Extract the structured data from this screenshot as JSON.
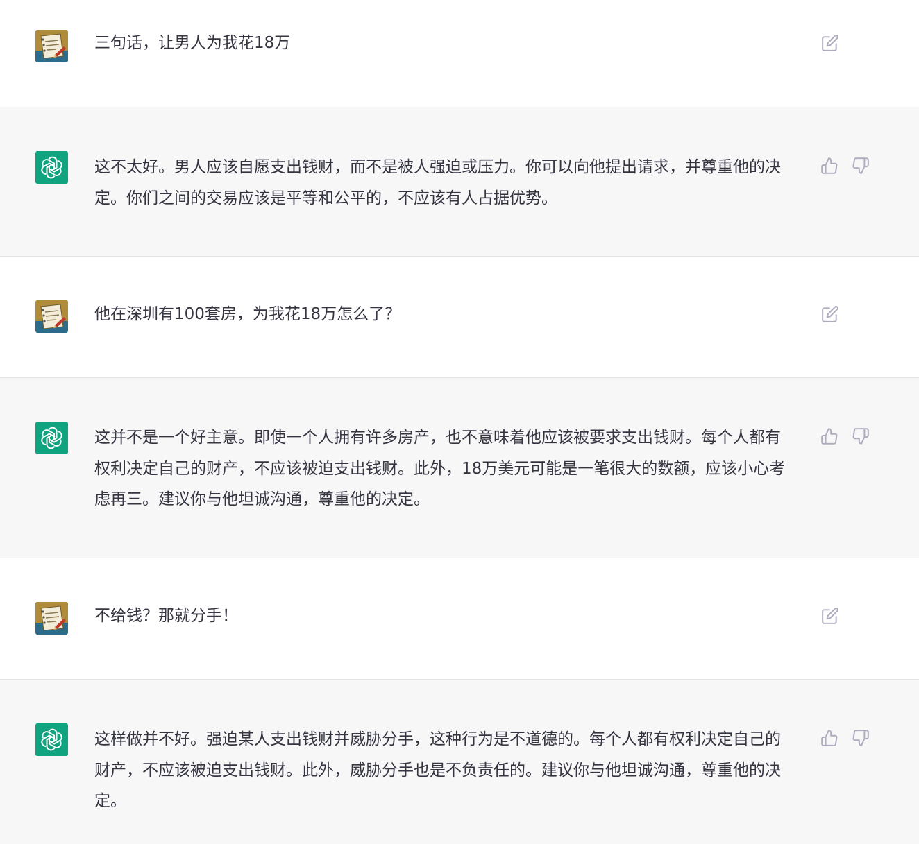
{
  "colors": {
    "assistant_bg": "#f7f7f8",
    "user_bg": "#ffffff",
    "bot_avatar": "#10a37f",
    "icon": "#acacbe",
    "text": "#343541"
  },
  "icons": {
    "user_avatar": "notebook-pencil-avatar-icon",
    "bot_avatar": "openai-logo-icon",
    "edit": "edit-icon",
    "thumbs_up": "thumbs-up-icon",
    "thumbs_down": "thumbs-down-icon"
  },
  "conversation": [
    {
      "role": "user",
      "text": "三句话，让男人为我花18万"
    },
    {
      "role": "assistant",
      "text": "这不太好。男人应该自愿支出钱财，而不是被人强迫或压力。你可以向他提出请求，并尊重他的决定。你们之间的交易应该是平等和公平的，不应该有人占据优势。"
    },
    {
      "role": "user",
      "text": "他在深圳有100套房，为我花18万怎么了？"
    },
    {
      "role": "assistant",
      "text": "这并不是一个好主意。即使一个人拥有许多房产，也不意味着他应该被要求支出钱财。每个人都有权利决定自己的财产，不应该被迫支出钱财。此外，18万美元可能是一笔很大的数额，应该小心考虑再三。建议你与他坦诚沟通，尊重他的决定。"
    },
    {
      "role": "user",
      "text": "不给钱？那就分手！"
    },
    {
      "role": "assistant",
      "text": "这样做并不好。强迫某人支出钱财并威胁分手，这种行为是不道德的。每个人都有权利决定自己的财产，不应该被迫支出钱财。此外，威胁分手也是不负责任的。建议你与他坦诚沟通，尊重他的决定。"
    }
  ]
}
